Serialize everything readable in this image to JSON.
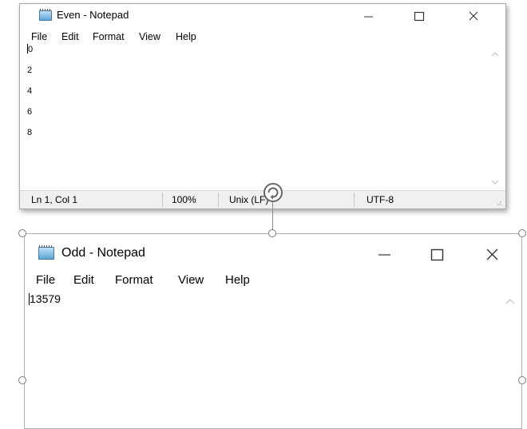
{
  "even_window": {
    "title": "Even - Notepad",
    "menu": [
      "File",
      "Edit",
      "Format",
      "View",
      "Help"
    ],
    "lines": [
      "0",
      "2",
      "4",
      "6",
      "8"
    ],
    "status": {
      "position": "Ln 1, Col 1",
      "zoom": "100%",
      "line_ending": "Unix (LF)",
      "encoding": "UTF-8"
    }
  },
  "odd_window": {
    "title": "Odd - Notepad",
    "menu": [
      "File",
      "Edit",
      "Format",
      "View",
      "Help"
    ],
    "lines": [
      "13579"
    ]
  },
  "icons": {
    "app": "notepad-icon",
    "minimize": "minimize-icon",
    "maximize": "maximize-icon",
    "close": "close-icon",
    "rotate": "rotate-handle-icon",
    "scroll_up": "chevron-up-icon",
    "scroll_down": "chevron-down-icon"
  }
}
